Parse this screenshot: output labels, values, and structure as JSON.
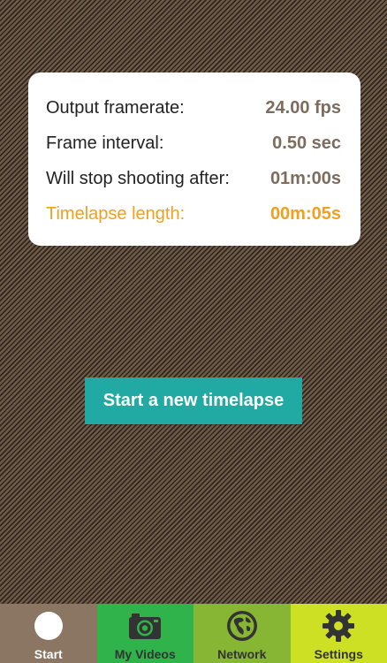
{
  "info": {
    "rows": [
      {
        "label": "Output framerate:",
        "value": "24.00 fps"
      },
      {
        "label": "Frame interval:",
        "value": "0.50 sec"
      },
      {
        "label": "Will stop shooting after:",
        "value": "01m:00s"
      },
      {
        "label": "Timelapse length:",
        "value": "00m:05s"
      }
    ]
  },
  "actions": {
    "start_label": "Start a new timelapse"
  },
  "tabbar": {
    "tabs": [
      {
        "label": "Start",
        "icon": "dot-icon",
        "selected": true
      },
      {
        "label": "My Videos",
        "icon": "camera-icon"
      },
      {
        "label": "Network",
        "icon": "globe-icon"
      },
      {
        "label": "Settings",
        "icon": "gear-icon"
      }
    ]
  },
  "colors": {
    "accent": "#21aaa3",
    "highlight": "#f0a020",
    "value": "#7d6c5d",
    "tab_start": "#8b7563",
    "tab_videos": "#2fb34a",
    "tab_network": "#86b634",
    "tab_settings": "#cde024"
  }
}
